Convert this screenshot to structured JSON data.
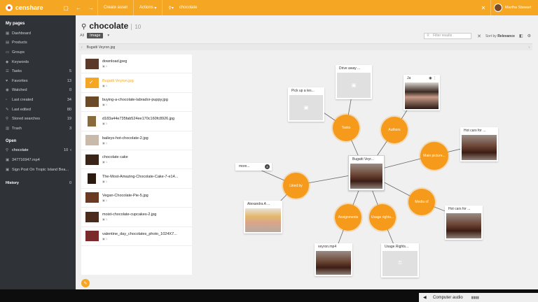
{
  "app": {
    "name": "censhare"
  },
  "topbar": {
    "create_asset": "Create asset",
    "actions": "Actions",
    "search_value": "chocolate",
    "user_name": "Martha Stewart"
  },
  "sidebar": {
    "my_pages_title": "My pages",
    "items": [
      {
        "label": "Dashboard",
        "count": ""
      },
      {
        "label": "Products",
        "count": ""
      },
      {
        "label": "Groups",
        "count": ""
      },
      {
        "label": "Keywords",
        "count": ""
      },
      {
        "label": "Tasks",
        "count": "5"
      },
      {
        "label": "Favorites",
        "count": "13"
      },
      {
        "label": "Watched",
        "count": "0"
      },
      {
        "label": "Last created",
        "count": "34"
      },
      {
        "label": "Last edited",
        "count": "80"
      },
      {
        "label": "Stored searches",
        "count": "19"
      },
      {
        "label": "Trash",
        "count": "3"
      }
    ],
    "open_title": "Open",
    "open_items": [
      {
        "label": "chocolate",
        "count": "10"
      },
      {
        "label": "347716947.mp4",
        "count": ""
      },
      {
        "label": "Sign Post On Tropic Island Bea...",
        "count": ""
      }
    ],
    "history_title": "History",
    "history_count": "0"
  },
  "header": {
    "title": "chocolate",
    "count": "10",
    "filter_all": "All",
    "filter_chip": "Image",
    "filter_placeholder": "Filter results",
    "sort_label": "Sort by",
    "sort_value": "Relevance"
  },
  "breadcrumb": {
    "current": "Bugatti Veyron.jpg"
  },
  "results": [
    {
      "name": "download.jpeg",
      "meta": "▣ 1"
    },
    {
      "name": "Bugatti Veyron.jpg",
      "meta": "▣ 1"
    },
    {
      "name": "buying-a-chocolate-labrador-puppy.jpg",
      "meta": "▣ 1"
    },
    {
      "name": "d183a44e735fab524ee170c160fc8926.jpg",
      "meta": "▣ 1"
    },
    {
      "name": "baileys-hot-chocolate-2.jpg",
      "meta": "▣ 1"
    },
    {
      "name": "chocolate cake",
      "meta": "▣ 1"
    },
    {
      "name": "The-Most-Amazing-Chocolate-Cake-7-e14...",
      "meta": "▣ 1"
    },
    {
      "name": "Vegan-Chocolate-Pie-5.jpg",
      "meta": "▣ 1"
    },
    {
      "name": "moist-chocolate-cupcakes-2.jpg",
      "meta": "▣ 1"
    },
    {
      "name": "valentine_day_chocolates_photo_1024X7...",
      "meta": "▣ 1"
    }
  ],
  "graph": {
    "center": {
      "label": "Bugatti Veyr..."
    },
    "relations": [
      {
        "label": "Tasks"
      },
      {
        "label": "Authors"
      },
      {
        "label": "Main picture..."
      },
      {
        "label": "Liked by"
      },
      {
        "label": "Media of"
      },
      {
        "label": "Assignments"
      },
      {
        "label": "Usage rights..."
      }
    ],
    "cards": {
      "pickup": "Pick up a tes...",
      "driveaway": "Drive away ...",
      "author": "Ja",
      "hotcars1": "Hot cars for ...",
      "more": "more...",
      "more_badge": "8",
      "alexandra": "Alexandra A ...",
      "hotcars2": "Hot cars for ...",
      "veyron_mp4": "veyron.mp4",
      "usage_rights": "Usage Rights..."
    }
  },
  "taskbar": {
    "audio_label": "Computer audio"
  }
}
